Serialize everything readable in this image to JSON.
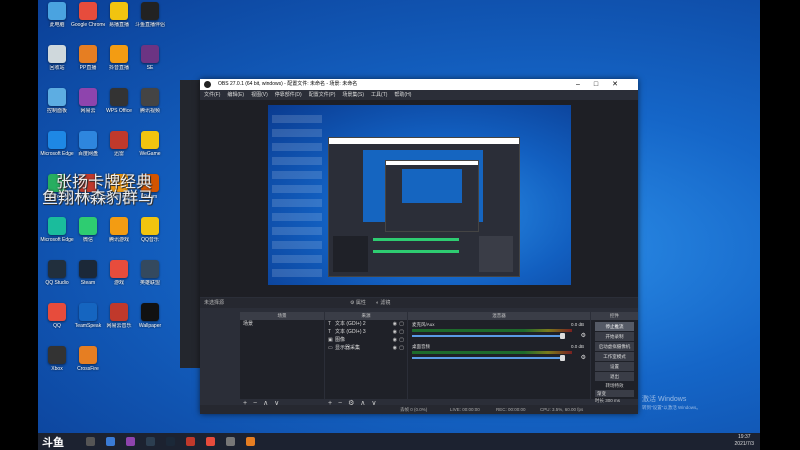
{
  "desktop": {
    "icons": [
      {
        "label": "此电脑",
        "color": "#4aa3e0"
      },
      {
        "label": "Google Chrome",
        "color": "#e74c3c"
      },
      {
        "label": "易播直播",
        "color": "#f1c40f"
      },
      {
        "label": "斗鱼直播伴侣",
        "color": "#222"
      },
      {
        "label": "回收站",
        "color": "#cfd8dc"
      },
      {
        "label": "PP直播",
        "color": "#e67e22"
      },
      {
        "label": "抖音直播",
        "color": "#f39c12"
      },
      {
        "label": "SE",
        "color": "#6c3483"
      },
      {
        "label": "控制面板",
        "color": "#5dade2"
      },
      {
        "label": "网易云",
        "color": "#8e44ad"
      },
      {
        "label": "WPS Office",
        "color": "#333"
      },
      {
        "label": "腾讯视频",
        "color": "#444"
      },
      {
        "label": "Microsoft Edge",
        "color": "#1e88e5"
      },
      {
        "label": "百度网盘",
        "color": "#2e86de"
      },
      {
        "label": "迅雷",
        "color": "#c0392b"
      },
      {
        "label": "WeGame",
        "color": "#f1c40f"
      },
      {
        "label": "GeForce",
        "color": "#27ae60"
      },
      {
        "label": "Among Us",
        "color": "#c0392b"
      },
      {
        "label": "League of Legends",
        "color": "#f39c12"
      },
      {
        "label": "Steam",
        "color": "#d35400"
      },
      {
        "label": "Microsoft Edge",
        "color": "#1abc9c"
      },
      {
        "label": "微信",
        "color": "#2ecc71"
      },
      {
        "label": "腾讯游戏",
        "color": "#f39c12"
      },
      {
        "label": "QQ音乐",
        "color": "#f1c40f"
      },
      {
        "label": "QQ Studio",
        "color": "#212f3d"
      },
      {
        "label": "Steam",
        "color": "#1b2838"
      },
      {
        "label": "游戏",
        "color": "#e74c3c"
      },
      {
        "label": "英雄联盟",
        "color": "#34495e"
      },
      {
        "label": "QQ",
        "color": "#e74c3c"
      },
      {
        "label": "TeamSpeak",
        "color": "#1565c0"
      },
      {
        "label": "网易云音乐",
        "color": "#c0392b"
      },
      {
        "label": "Wallpaper",
        "color": "#111"
      },
      {
        "label": "Xbox",
        "color": "#333"
      },
      {
        "label": "CrossFire",
        "color": "#e67e22"
      }
    ],
    "watermark_line1": "张扬卡牌经典",
    "watermark_line2": "鱼翔林森豹群马"
  },
  "obs": {
    "title": "OBS 27.0.1 (64 bit, windows) - 配置文件: 未命名 - 场景: 未命名",
    "menu": [
      "文件(F)",
      "编辑(E)",
      "视图(V)",
      "停靠部件(D)",
      "配置文件(P)",
      "场景集(S)",
      "工具(T)",
      "帮助(H)"
    ],
    "scene_label": "未选择源",
    "ctrl_props": "属性",
    "ctrl_filters": "滤镜",
    "docks": {
      "scenes": "场景",
      "sources": "来源",
      "mixer": "混音器",
      "transitions": "转场特效",
      "controls": "控件"
    },
    "scenes": [
      "场景"
    ],
    "sources": [
      {
        "icon": "T",
        "name": "文本 (GDI+) 2"
      },
      {
        "icon": "T",
        "name": "文本 (GDI+) 3"
      },
      {
        "icon": "▣",
        "name": "图像"
      },
      {
        "icon": "▭",
        "name": "显示器采集"
      }
    ],
    "mixer": [
      {
        "name": "麦克风/Aux",
        "level": "0.0 dB"
      },
      {
        "name": "桌面音频",
        "level": "0.0 dB"
      }
    ],
    "controls": [
      "停止推流",
      "开始录制",
      "启动虚拟摄像机",
      "工作室模式",
      "设置",
      "退出"
    ],
    "transition_label": "转场特效",
    "transition_type": "渐变",
    "duration_label": "时长",
    "duration_value": "300 ms",
    "status": {
      "dropped": "丢帧 0 (0.0%)",
      "live": "LIVE: 00:00:00",
      "rec": "REC: 00:00:00",
      "cpu": "CPU: 3.5%, 60.00 fps",
      "bitrate": "kb/s: 0"
    }
  },
  "taskbar": {
    "logo": "斗鱼",
    "time": "19:37",
    "date": "2021/7/3"
  },
  "activation": {
    "line1": "激活 Windows",
    "line2": "转到\"设置\"以激活 Windows。"
  }
}
